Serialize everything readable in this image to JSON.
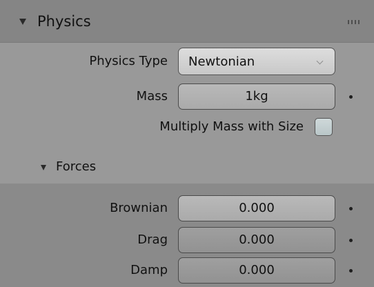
{
  "panel": {
    "title": "Physics",
    "grip_icon": "drag-grip-icon"
  },
  "physics_type": {
    "label": "Physics Type",
    "value": "Newtonian"
  },
  "mass": {
    "label": "Mass",
    "value": "1kg"
  },
  "multiply_mass": {
    "label": "Multiply Mass with Size",
    "checked": false
  },
  "forces": {
    "title": "Forces",
    "fields": [
      {
        "label": "Brownian",
        "value": "0.000"
      },
      {
        "label": "Drag",
        "value": "0.000"
      },
      {
        "label": "Damp",
        "value": "0.000"
      }
    ]
  },
  "colors": {
    "panel_bg": "#999999",
    "header_bg": "#858585",
    "subpanel_bg": "#8a8a8a",
    "text": "#111111"
  }
}
